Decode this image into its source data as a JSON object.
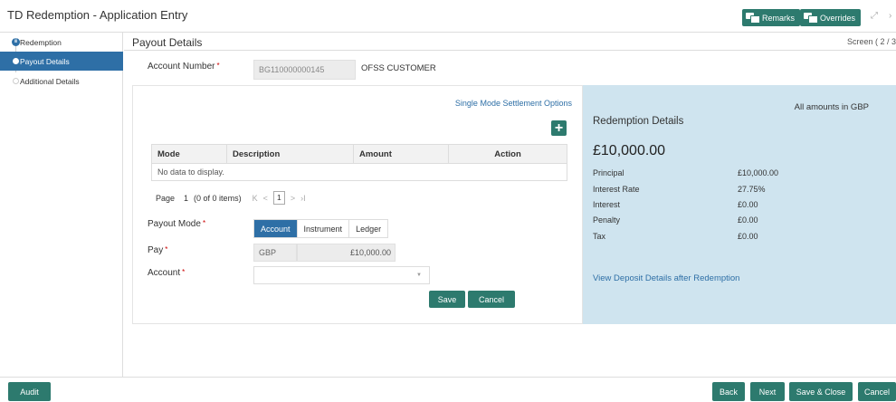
{
  "window": {
    "title": "TD Redemption - Application Entry",
    "remarks_label": "Remarks",
    "overrides_label": "Overrides",
    "maximize_glyph": "⤢",
    "close_glyph": "›"
  },
  "sidebar": {
    "items": [
      {
        "label": "Redemption",
        "state": "completed"
      },
      {
        "label": "Payout Details",
        "state": "active"
      },
      {
        "label": "Additional Details",
        "state": "pending"
      }
    ]
  },
  "main": {
    "header": "Payout Details",
    "screen_indicator": "Screen ( 2 / 3"
  },
  "account": {
    "label": "Account Number",
    "number": "BG110000000145",
    "name": "OFSS CUSTOMER"
  },
  "settlement": {
    "options_link": "Single Mode Settlement Options",
    "add_glyph": "+",
    "grid": {
      "columns": [
        "Mode",
        "Description",
        "Amount",
        "Action"
      ],
      "empty_text": "No data to display."
    },
    "pager": {
      "page_label": "Page",
      "page_number": "1",
      "items_text": "(0 of 0 items)",
      "current_box": "1",
      "first_glyph": "K",
      "prev_glyph": "<",
      "next_glyph": ">",
      "last_glyph": "›I"
    }
  },
  "form": {
    "payout_mode_label": "Payout Mode",
    "modes": [
      "Account",
      "Instrument",
      "Ledger"
    ],
    "selected_mode": "Account",
    "pay_label": "Pay",
    "pay_currency": "GBP",
    "pay_amount": "£10,000.00",
    "account_label": "Account",
    "account_value": "",
    "save_label": "Save",
    "cancel_label": "Cancel"
  },
  "redemption": {
    "amounts_note": "All amounts in GBP",
    "title": "Redemption Details",
    "total": "£10,000.00",
    "rows": [
      {
        "label": "Principal",
        "value": "£10,000.00"
      },
      {
        "label": "Interest Rate",
        "value": "27.75%"
      },
      {
        "label": "Interest",
        "value": "£0.00"
      },
      {
        "label": "Penalty",
        "value": "£0.00"
      },
      {
        "label": "Tax",
        "value": "£0.00"
      }
    ],
    "link": "View Deposit Details after Redemption"
  },
  "footer": {
    "audit": "Audit",
    "back": "Back",
    "next": "Next",
    "save_close": "Save & Close",
    "cancel": "Cancel"
  },
  "colors": {
    "brand_blue": "#2e6fa6",
    "button_green": "#2d7a6e",
    "panel_blue": "#cfe4ef"
  }
}
